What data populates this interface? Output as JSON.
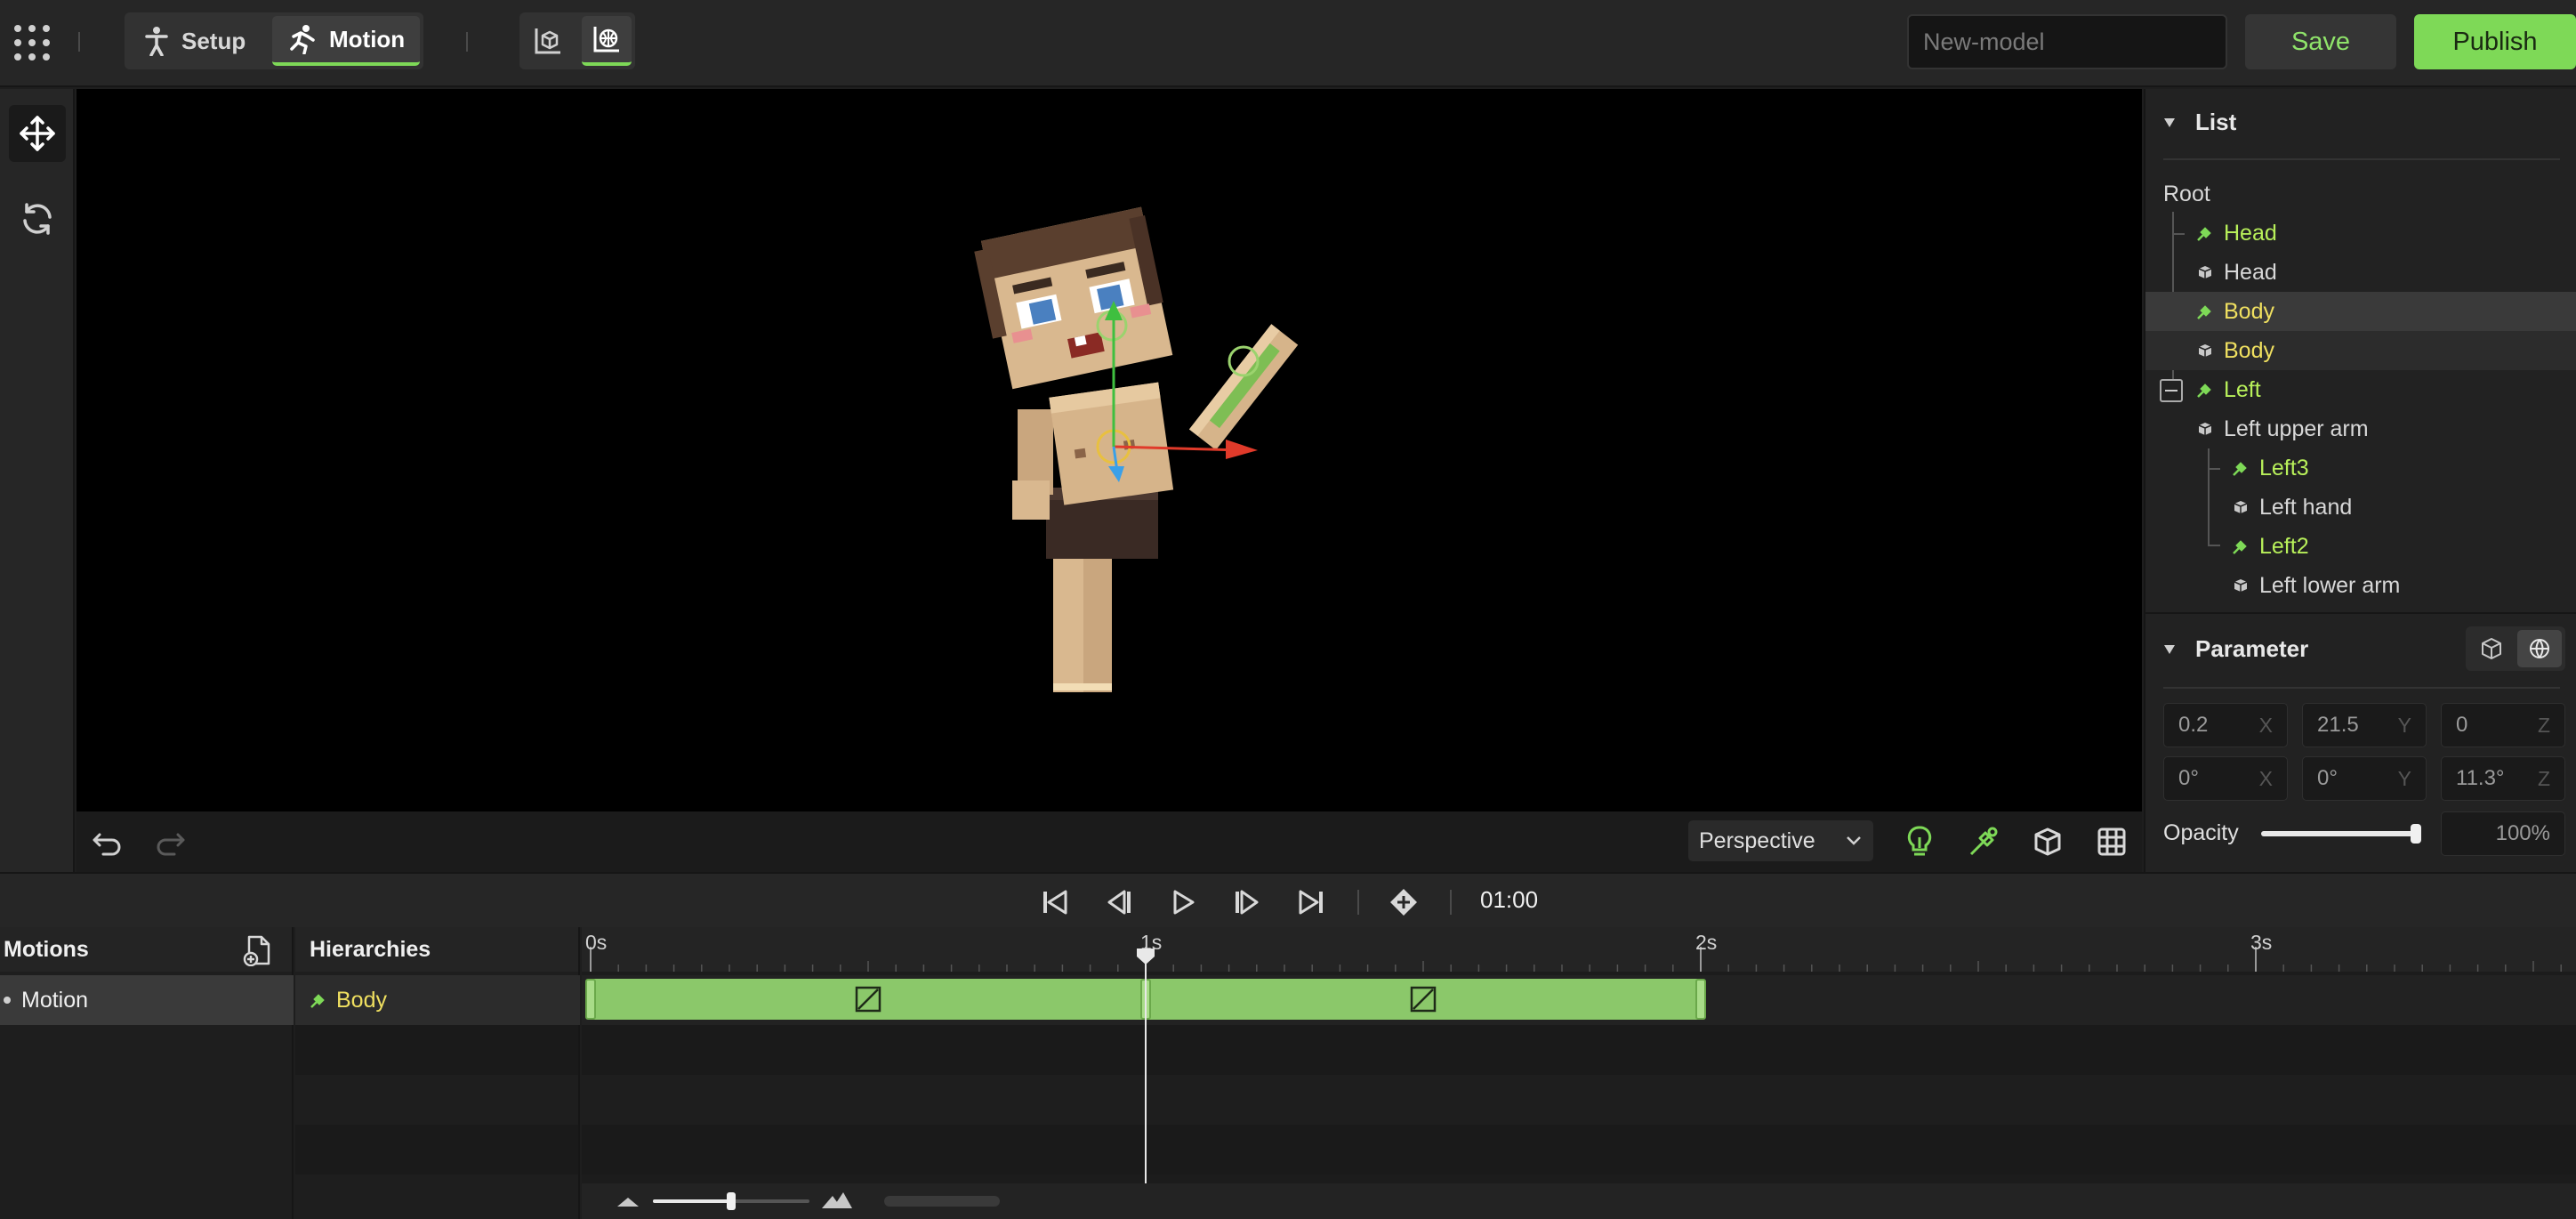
{
  "topbar": {
    "modes": [
      {
        "label": "Setup",
        "icon": "person-standing-icon",
        "active": false
      },
      {
        "label": "Motion",
        "icon": "person-running-icon",
        "active": true
      }
    ],
    "view_buttons": [
      "mesh-view-icon",
      "bone-view-icon"
    ],
    "model_name_placeholder": "New-model",
    "save_label": "Save",
    "publish_label": "Publish"
  },
  "left_tools": [
    "move-icon",
    "rotate-icon"
  ],
  "viewport": {
    "projection": "Perspective",
    "toggles": [
      "light-bulb-icon",
      "bone-pen-icon",
      "cube-icon",
      "grid-icon",
      "target-icon"
    ]
  },
  "list_panel": {
    "title": "List",
    "root_label": "Root",
    "items": [
      {
        "label": "Head",
        "kind": "bone"
      },
      {
        "label": "Head",
        "kind": "mesh"
      },
      {
        "label": "Body",
        "kind": "bone",
        "selected": true
      },
      {
        "label": "Body",
        "kind": "mesh"
      },
      {
        "label": "Left",
        "kind": "bone"
      },
      {
        "label": "Left upper arm",
        "kind": "mesh"
      },
      {
        "label": "Left3",
        "kind": "bone"
      },
      {
        "label": "Left hand",
        "kind": "mesh"
      },
      {
        "label": "Left2",
        "kind": "bone"
      },
      {
        "label": "Left lower arm",
        "kind": "mesh"
      }
    ]
  },
  "parameter_panel": {
    "title": "Parameter",
    "position": [
      {
        "value": "0.2",
        "axis": "X"
      },
      {
        "value": "21.5",
        "axis": "Y"
      },
      {
        "value": "0",
        "axis": "Z"
      }
    ],
    "rotation": [
      {
        "value": "0°",
        "axis": "X"
      },
      {
        "value": "0°",
        "axis": "Y"
      },
      {
        "value": "11.3°",
        "axis": "Z"
      }
    ],
    "opacity_label": "Opacity",
    "opacity_value": "100%",
    "opacity_fraction": 1.0
  },
  "transport": {
    "time": "01:00"
  },
  "motions_panel": {
    "title": "Motions",
    "items": [
      "Motion"
    ]
  },
  "hierarchies_panel": {
    "title": "Hierarchies",
    "items": [
      "Body"
    ]
  },
  "timeline": {
    "ticks": [
      "0s",
      "1s",
      "2s",
      "3s"
    ],
    "playhead_seconds": 1.0,
    "clip_start_seconds": 0.0,
    "clip_end_seconds": 2.0,
    "keyframes_seconds": [
      0.0,
      1.0,
      2.0
    ],
    "zoom_fraction": 0.5,
    "colors": {
      "clip": "#8bc86a",
      "accent": "#7ed957",
      "bone": "#b8f05a",
      "body": "#f0e060"
    }
  }
}
